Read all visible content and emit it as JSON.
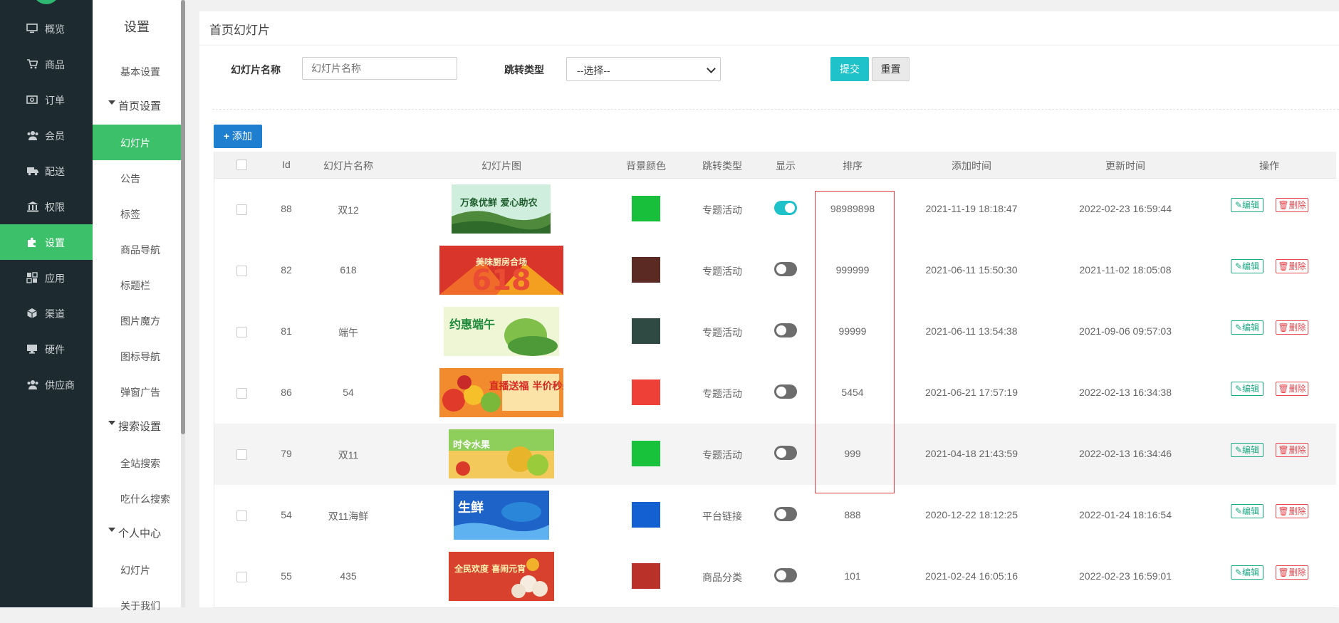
{
  "nav": {
    "items": [
      {
        "label": "概览",
        "icon": "monitor-icon"
      },
      {
        "label": "商品",
        "icon": "cart-icon"
      },
      {
        "label": "订单",
        "icon": "money-icon"
      },
      {
        "label": "会员",
        "icon": "users-icon"
      },
      {
        "label": "配送",
        "icon": "truck-icon"
      },
      {
        "label": "权限",
        "icon": "bank-icon"
      },
      {
        "label": "设置",
        "icon": "puzzle-icon",
        "active": true
      },
      {
        "label": "应用",
        "icon": "apps-icon"
      },
      {
        "label": "渠道",
        "icon": "cube-icon"
      },
      {
        "label": "硬件",
        "icon": "desktop-icon"
      },
      {
        "label": "供应商",
        "icon": "supplier-icon"
      }
    ]
  },
  "subnav": {
    "title": "设置",
    "basic": "基本设置",
    "group_home": "首页设置",
    "home_items": [
      "幻灯片",
      "公告",
      "标签",
      "商品导航",
      "标题栏",
      "图片魔方",
      "图标导航",
      "弹窗广告"
    ],
    "group_search": "搜索设置",
    "search_items": [
      "全站搜索",
      "吃什么搜索"
    ],
    "group_personal": "个人中心",
    "personal_items": [
      "幻灯片",
      "关于我们"
    ]
  },
  "main": {
    "title": "首页幻灯片",
    "filter": {
      "name_label": "幻灯片名称",
      "name_placeholder": "幻灯片名称",
      "type_label": "跳转类型",
      "type_selected": "--选择--",
      "submit": "提交",
      "reset": "重置"
    },
    "add_label": "添加"
  },
  "table": {
    "headers": [
      "Id",
      "幻灯片名称",
      "幻灯片图",
      "背景颜色",
      "跳转类型",
      "显示",
      "排序",
      "添加时间",
      "更新时间",
      "操作"
    ],
    "edit_label": "编辑",
    "delete_label": "删除",
    "rows": [
      {
        "id": "88",
        "name": "双12",
        "color": "#17bf3b",
        "type": "专题活动",
        "show": true,
        "sort": "98989898",
        "added": "2021-11-19 18:18:47",
        "updated": "2022-02-23 16:59:44",
        "banner_text": "万象优鲜 爱心助农"
      },
      {
        "id": "82",
        "name": "618",
        "color": "#5b2a22",
        "type": "专题活动",
        "show": false,
        "sort": "999999",
        "added": "2021-06-11 15:50:30",
        "updated": "2021-11-02 18:05:08",
        "banner_text": "美味厨房合场"
      },
      {
        "id": "81",
        "name": "端午",
        "color": "#2f4a43",
        "type": "专题活动",
        "show": false,
        "sort": "99999",
        "added": "2021-06-11 13:54:38",
        "updated": "2021-09-06 09:57:03",
        "banner_text": "约惠端午"
      },
      {
        "id": "86",
        "name": "54",
        "color": "#ee4036",
        "type": "专题活动",
        "show": false,
        "sort": "5454",
        "added": "2021-06-21 17:57:19",
        "updated": "2022-02-13 16:34:38",
        "banner_text": "直播送福 半价秒杀"
      },
      {
        "id": "79",
        "name": "双11",
        "color": "#18c23b",
        "type": "专题活动",
        "show": false,
        "sort": "999",
        "added": "2021-04-18 21:43:59",
        "updated": "2022-02-13 16:34:46",
        "banner_text": "时令水果"
      },
      {
        "id": "54",
        "name": "双11海鲜",
        "color": "#1260d2",
        "type": "平台链接",
        "show": false,
        "sort": "888",
        "added": "2020-12-22 18:12:25",
        "updated": "2022-01-24 18:16:54",
        "banner_text": "生鲜"
      },
      {
        "id": "55",
        "name": "435",
        "color": "#b93128",
        "type": "商品分类",
        "show": false,
        "sort": "101",
        "added": "2021-02-24 16:05:16",
        "updated": "2022-02-23 16:59:01",
        "banner_text": "全民欢度 喜闹元宵"
      }
    ]
  }
}
